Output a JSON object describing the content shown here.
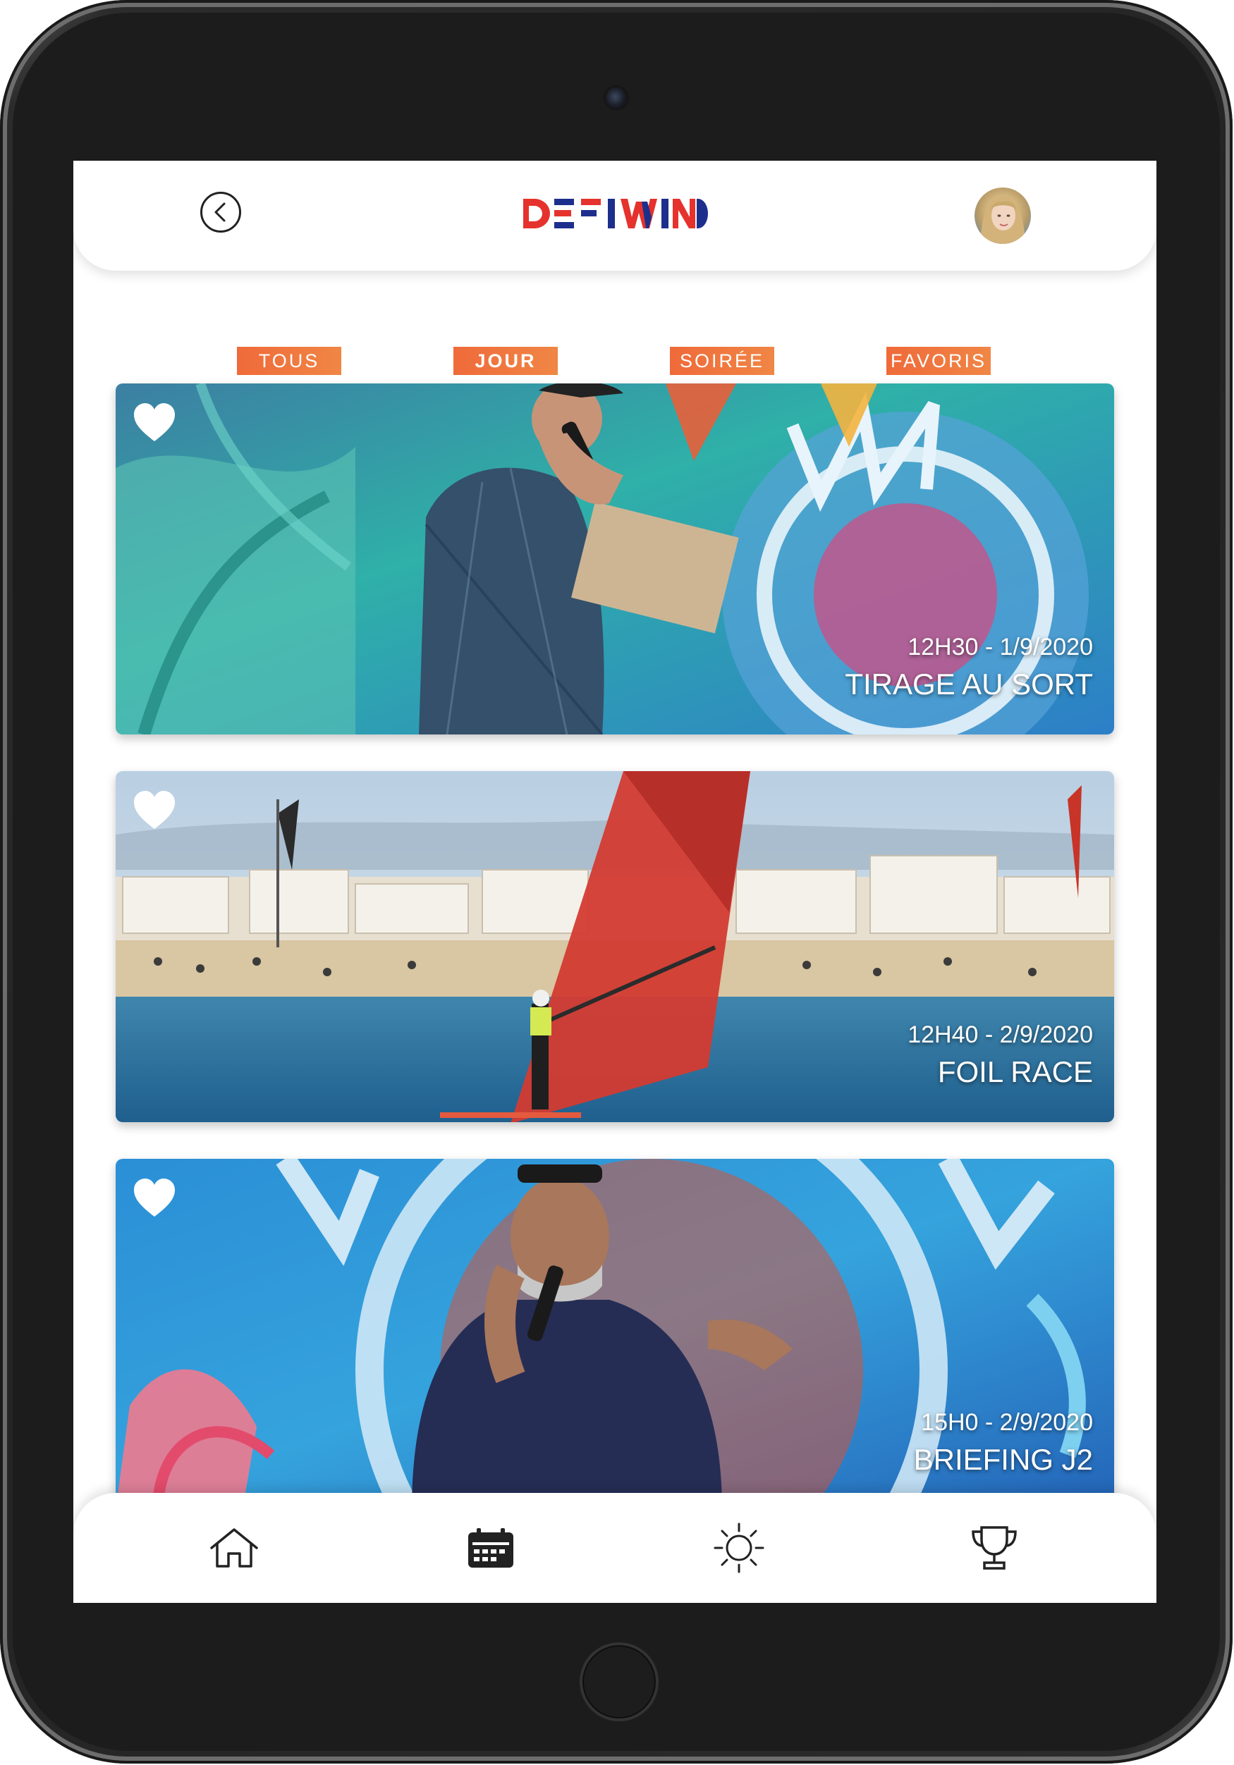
{
  "header": {
    "logo_text": "DEFIWIND"
  },
  "filters": [
    {
      "label": "TOUS",
      "active": false
    },
    {
      "label": "JOUR",
      "active": true
    },
    {
      "label": "SOIRÉE",
      "active": false
    },
    {
      "label": "FAVORIS",
      "active": false
    }
  ],
  "events": [
    {
      "date": "12H30 - 1/9/2020",
      "title": "TIRAGE AU SORT"
    },
    {
      "date": "12H40 - 2/9/2020",
      "title": "FOIL RACE"
    },
    {
      "date": "15H0 - 2/9/2020",
      "title": "BRIEFING J2"
    }
  ],
  "nav": [
    {
      "icon": "home-icon"
    },
    {
      "icon": "calendar-icon"
    },
    {
      "icon": "sun-icon"
    },
    {
      "icon": "trophy-icon"
    }
  ],
  "colors": {
    "accent": "#ef6a3a",
    "logo_red": "#e5322d",
    "logo_blue": "#1d2f8c"
  }
}
